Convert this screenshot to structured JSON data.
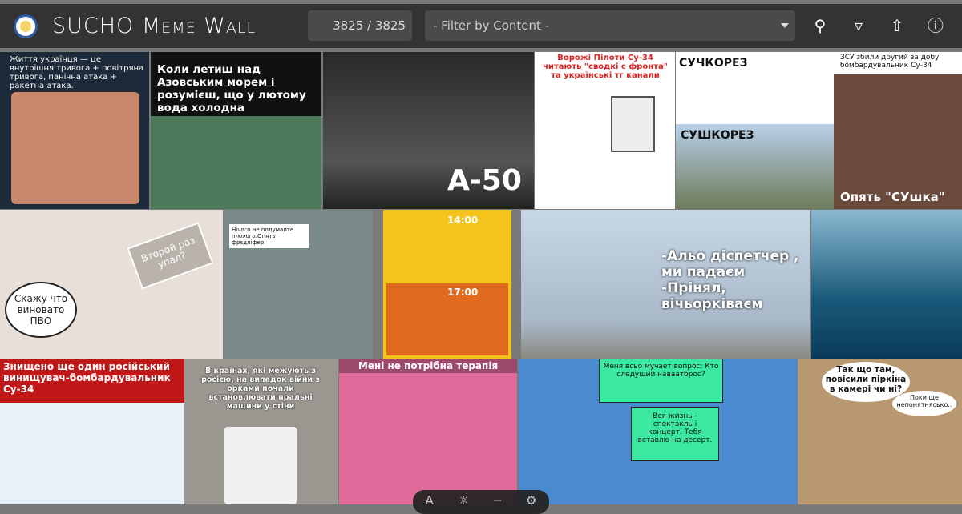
{
  "header": {
    "title": "SUCHO Meme Wall",
    "count": "3825 / 3825",
    "filter_placeholder": "- Filter by Content -"
  },
  "icons": [
    "search-icon",
    "filter-icon",
    "upload-icon",
    "info-icon"
  ],
  "tiles": [
    {
      "text": "Життя українця — це внутрішня тривога + повітряна тривога, панічна атака + ракетна атака."
    },
    {
      "text": "Коли летиш над Азовським морем і розумієш, що у лютому вода холодна"
    },
    {
      "text": "А-50"
    },
    {
      "text": "Ворожі Пілоти Су-34 читають \"сводкі с фронта\" та українські тг канали"
    },
    {
      "text": "СУЧКОРЕЗ",
      "text2": "СУШКОРЕЗ"
    },
    {
      "text": "ЗСУ збили другий за добу бомбардувальник Су-34",
      "text2": "Опять \"СУшка\""
    },
    {
      "text": "Скажу что виновато ПВО",
      "text2": "Второй раз упал?"
    },
    {
      "text": "Нічого не подумайте плохого.Опять фрєдліфер"
    },
    {
      "text": "14:00",
      "text2": "17:00"
    },
    {
      "text": "-Альо діспетчер , ми падаєм -Прінял, вічьорківаєм"
    },
    {
      "text": ""
    },
    {
      "text": "Знищено ще один російський винищувач-бомбардувальник Су-34"
    },
    {
      "text": "В країнах, які межують з росією, на випадок війни з орками почали встановлювати пральні машини у стіни"
    },
    {
      "text": "Мені не потрібна терапія"
    },
    {
      "text": "Меня всьо мучает вопрос: Кто следущий наваатброс?",
      "text2": "Вся жизнь - спектакль і концерт. Тебя вставлю на десерт."
    },
    {
      "text": "Так що там, повісили піркіна в камері чи ні?",
      "text2": "Поки ще непонятнясько.."
    }
  ]
}
